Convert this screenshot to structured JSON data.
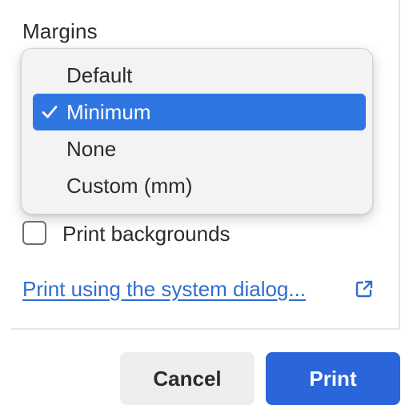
{
  "margins": {
    "label": "Margins",
    "options": [
      {
        "label": "Default",
        "selected": false
      },
      {
        "label": "Minimum",
        "selected": true
      },
      {
        "label": "None",
        "selected": false
      },
      {
        "label": "Custom (mm)",
        "selected": false
      }
    ],
    "selected_value": "Minimum",
    "check_icon": "checkmark-icon"
  },
  "print_backgrounds": {
    "label": "Print backgrounds",
    "checked": false
  },
  "system_dialog_link": {
    "label": "Print using the system dialog...",
    "icon": "external-link-icon"
  },
  "buttons": {
    "cancel": "Cancel",
    "print": "Print"
  },
  "colors": {
    "accent": "#2f76e3",
    "primary_button": "#2a66d9",
    "link": "#2f6ecf",
    "secondary_button": "#eeeeee"
  }
}
